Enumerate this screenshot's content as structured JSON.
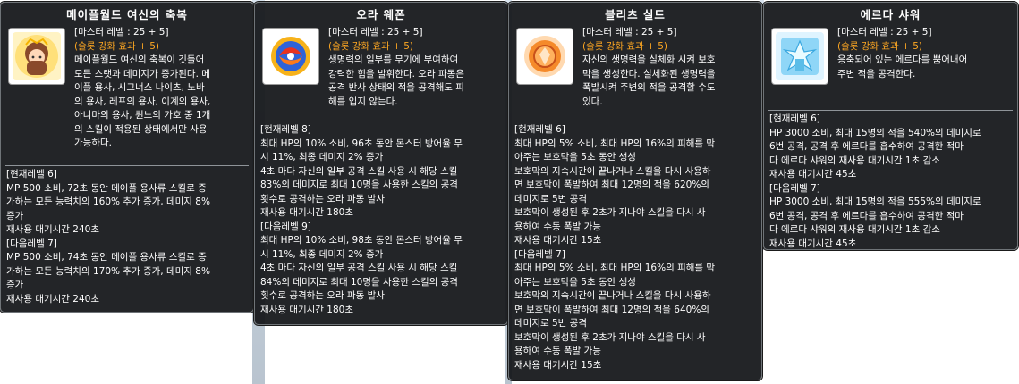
{
  "panels": [
    {
      "title": "메이플월드 여신의 축복",
      "icon": "goddess-portrait-icon",
      "master_level": "[마스터 레벨 : 25 + 5]",
      "bonus": "(슬롯 강화 효과 + 5)",
      "description": [
        "메이플월드 여신의 축복이 깃들어",
        "모든 스탯과 데미지가 증가된다. 메",
        "이플 용사, 시그너스 나이츠, 노바",
        "의 용사, 레프의 용사, 이계의 용사,",
        "아니마의 용사, 륀느의 가호 중 1개",
        "의 스킬이 적용된 상태에서만 사용",
        "가능하다."
      ],
      "current_label": "[현재레벨 6]",
      "current": [
        "MP 500 소비, 72초 동안 메이플 용사류 스킬로 증",
        "가하는 모든 능력치의 160% 추가 증가, 데미지 8%",
        "증가",
        "재사용 대기시간 240초"
      ],
      "next_label": "[다음레벨 7]",
      "next": [
        "MP 500 소비, 74초 동안 메이플 용사류 스킬로 증",
        "가하는 모든 능력치의 170% 추가 증가, 데미지 8%",
        "증가",
        "재사용 대기시간 240초"
      ]
    },
    {
      "title": "오라 웨폰",
      "icon": "aura-weapon-icon",
      "master_level": "[마스터 레벨 : 25 + 5]",
      "bonus": "(슬롯 강화 효과 + 5)",
      "description": [
        "생명력의 일부를 무기에 부여하여",
        "강력한 힘을 발휘한다. 오라 파동은",
        "공격 반사 상태의 적을 공격해도 피",
        "해를 입지 않는다."
      ],
      "current_label": "[현재레벨 8]",
      "current": [
        "최대 HP의 10% 소비, 96초 동안 몬스터 방어율 무",
        "시 11%, 최종 데미지 2% 증가",
        "4초 마다 자신의 일부 공격 스킬 사용 시 해당 스킬",
        "83%의 데미지로 최대 10명을 사용한 스킬의 공격",
        "횟수로 공격하는 오라 파동 발사",
        "재사용 대기시간 180초"
      ],
      "next_label": "[다음레벨 9]",
      "next": [
        "최대 HP의 10% 소비, 98초 동안 몬스터 방어율 무",
        "시 11%, 최종 데미지 2% 증가",
        "4초 마다 자신의 일부 공격 스킬 사용 시 해당 스킬",
        "84%의 데미지로 최대 10명을 사용한 스킬의 공격",
        "횟수로 공격하는 오라 파동 발사",
        "재사용 대기시간 180초"
      ]
    },
    {
      "title": "블리츠 실드",
      "icon": "blitz-shield-icon",
      "master_level": "[마스터 레벨 : 25 + 5]",
      "bonus": "(슬롯 강화 효과 + 5)",
      "description": [
        "자신의 생명력을 실체화 시켜 보호",
        "막을 생성한다. 실체화된 생명력을",
        "폭발시켜 주변의 적을 공격할 수도",
        "있다."
      ],
      "current_label": "[현재레벨 6]",
      "current": [
        "최대 HP의 5% 소비, 최대 HP의 16%의 피해를 막",
        "아주는 보호막을 5초 동안 생성",
        "보호막의 지속시간이 끝나거나 스킬을 다시 사용하",
        "면 보호막이 폭발하여 최대 12명의 적을 620%의",
        "데미지로 5번 공격",
        "보호막이 생성된 후 2초가 지나야 스킬을 다시 사",
        "용하여 수동 폭발 가능",
        "재사용 대기시간 15초"
      ],
      "next_label": "[다음레벨 7]",
      "next": [
        "최대 HP의 5% 소비, 최대 HP의 16%의 피해를 막",
        "아주는 보호막을 5초 동안 생성",
        "보호막의 지속시간이 끝나거나 스킬을 다시 사용하",
        "면 보호막이 폭발하여 최대 12명의 적을 640%의",
        "데미지로 5번 공격",
        "보호막이 생성된 후 2초가 지나야 스킬을 다시 사",
        "용하여 수동 폭발 가능",
        "재사용 대기시간 15초"
      ]
    },
    {
      "title": "에르다 샤워",
      "icon": "erda-shower-icon",
      "master_level": "[마스터 레벨 : 25 + 5]",
      "bonus": "(슬롯 강화 효과 + 5)",
      "description": [
        "응축되어 있는 에르다를 뿜어내어",
        "주변 적을 공격한다."
      ],
      "current_label": "[현재레벨 6]",
      "current": [
        "HP 3000 소비, 최대 15명의 적을 540%의 데미지로",
        "6번 공격, 공격 후 에르다를 흡수하여 공격한 적마",
        "다 에르다 샤워의 재사용 대기시간 1초 감소",
        "재사용 대기시간 45초"
      ],
      "next_label": "[다음레벨 7]",
      "next": [
        "HP 3000 소비, 최대 15명의 적을 555%의 데미지로",
        "6번 공격, 공격 후 에르다를 흡수하여 공격한 적마",
        "다 에르다 샤워의 재사용 대기시간 1초 감소",
        "재사용 대기시간 45초"
      ]
    }
  ],
  "colors": {
    "bonus": "#ffa822",
    "tooltip_bg": "#131418",
    "border": "#6f7478"
  }
}
